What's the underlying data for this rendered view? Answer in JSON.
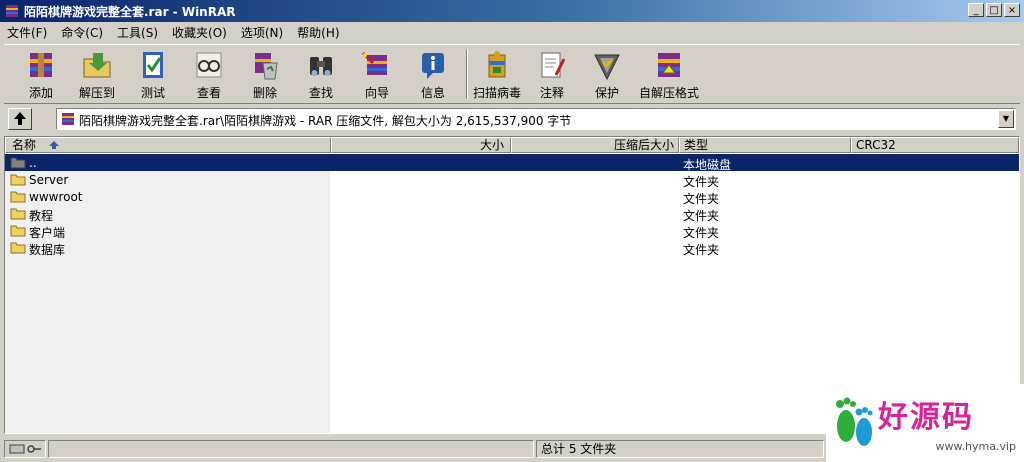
{
  "window": {
    "title": "陌陌棋牌游戏完整全套.rar - WinRAR"
  },
  "menu": [
    "文件(F)",
    "命令(C)",
    "工具(S)",
    "收藏夹(O)",
    "选项(N)",
    "帮助(H)"
  ],
  "toolbar": {
    "add": "添加",
    "extract_to": "解压到",
    "test": "测试",
    "view": "查看",
    "delete": "删除",
    "find": "查找",
    "wizard": "向导",
    "info": "信息",
    "virus_scan": "扫描病毒",
    "comment": "注释",
    "protect": "保护",
    "sfx": "自解压格式"
  },
  "address": {
    "path": "陌陌棋牌游戏完整全套.rar\\陌陌棋牌游戏 - RAR 压缩文件, 解包大小为 2,615,537,900 字节"
  },
  "columns": {
    "name": "名称",
    "size": "大小",
    "packed": "压缩后大小",
    "type": "类型",
    "crc": "CRC32"
  },
  "rows": [
    {
      "name": "..",
      "type": "本地磁盘"
    },
    {
      "name": "Server",
      "type": "文件夹"
    },
    {
      "name": "wwwroot",
      "type": "文件夹"
    },
    {
      "name": "教程",
      "type": "文件夹"
    },
    {
      "name": "客户端",
      "type": "文件夹"
    },
    {
      "name": "数据库",
      "type": "文件夹"
    }
  ],
  "status": {
    "summary": "总计 5 文件夹"
  },
  "watermark": {
    "text": "好源码",
    "url": "www.hyma.vip"
  },
  "colors": {
    "selection": "#0a246a",
    "title_start": "#0a246a",
    "title_end": "#a6caf0",
    "watermark": "#d6249a"
  }
}
